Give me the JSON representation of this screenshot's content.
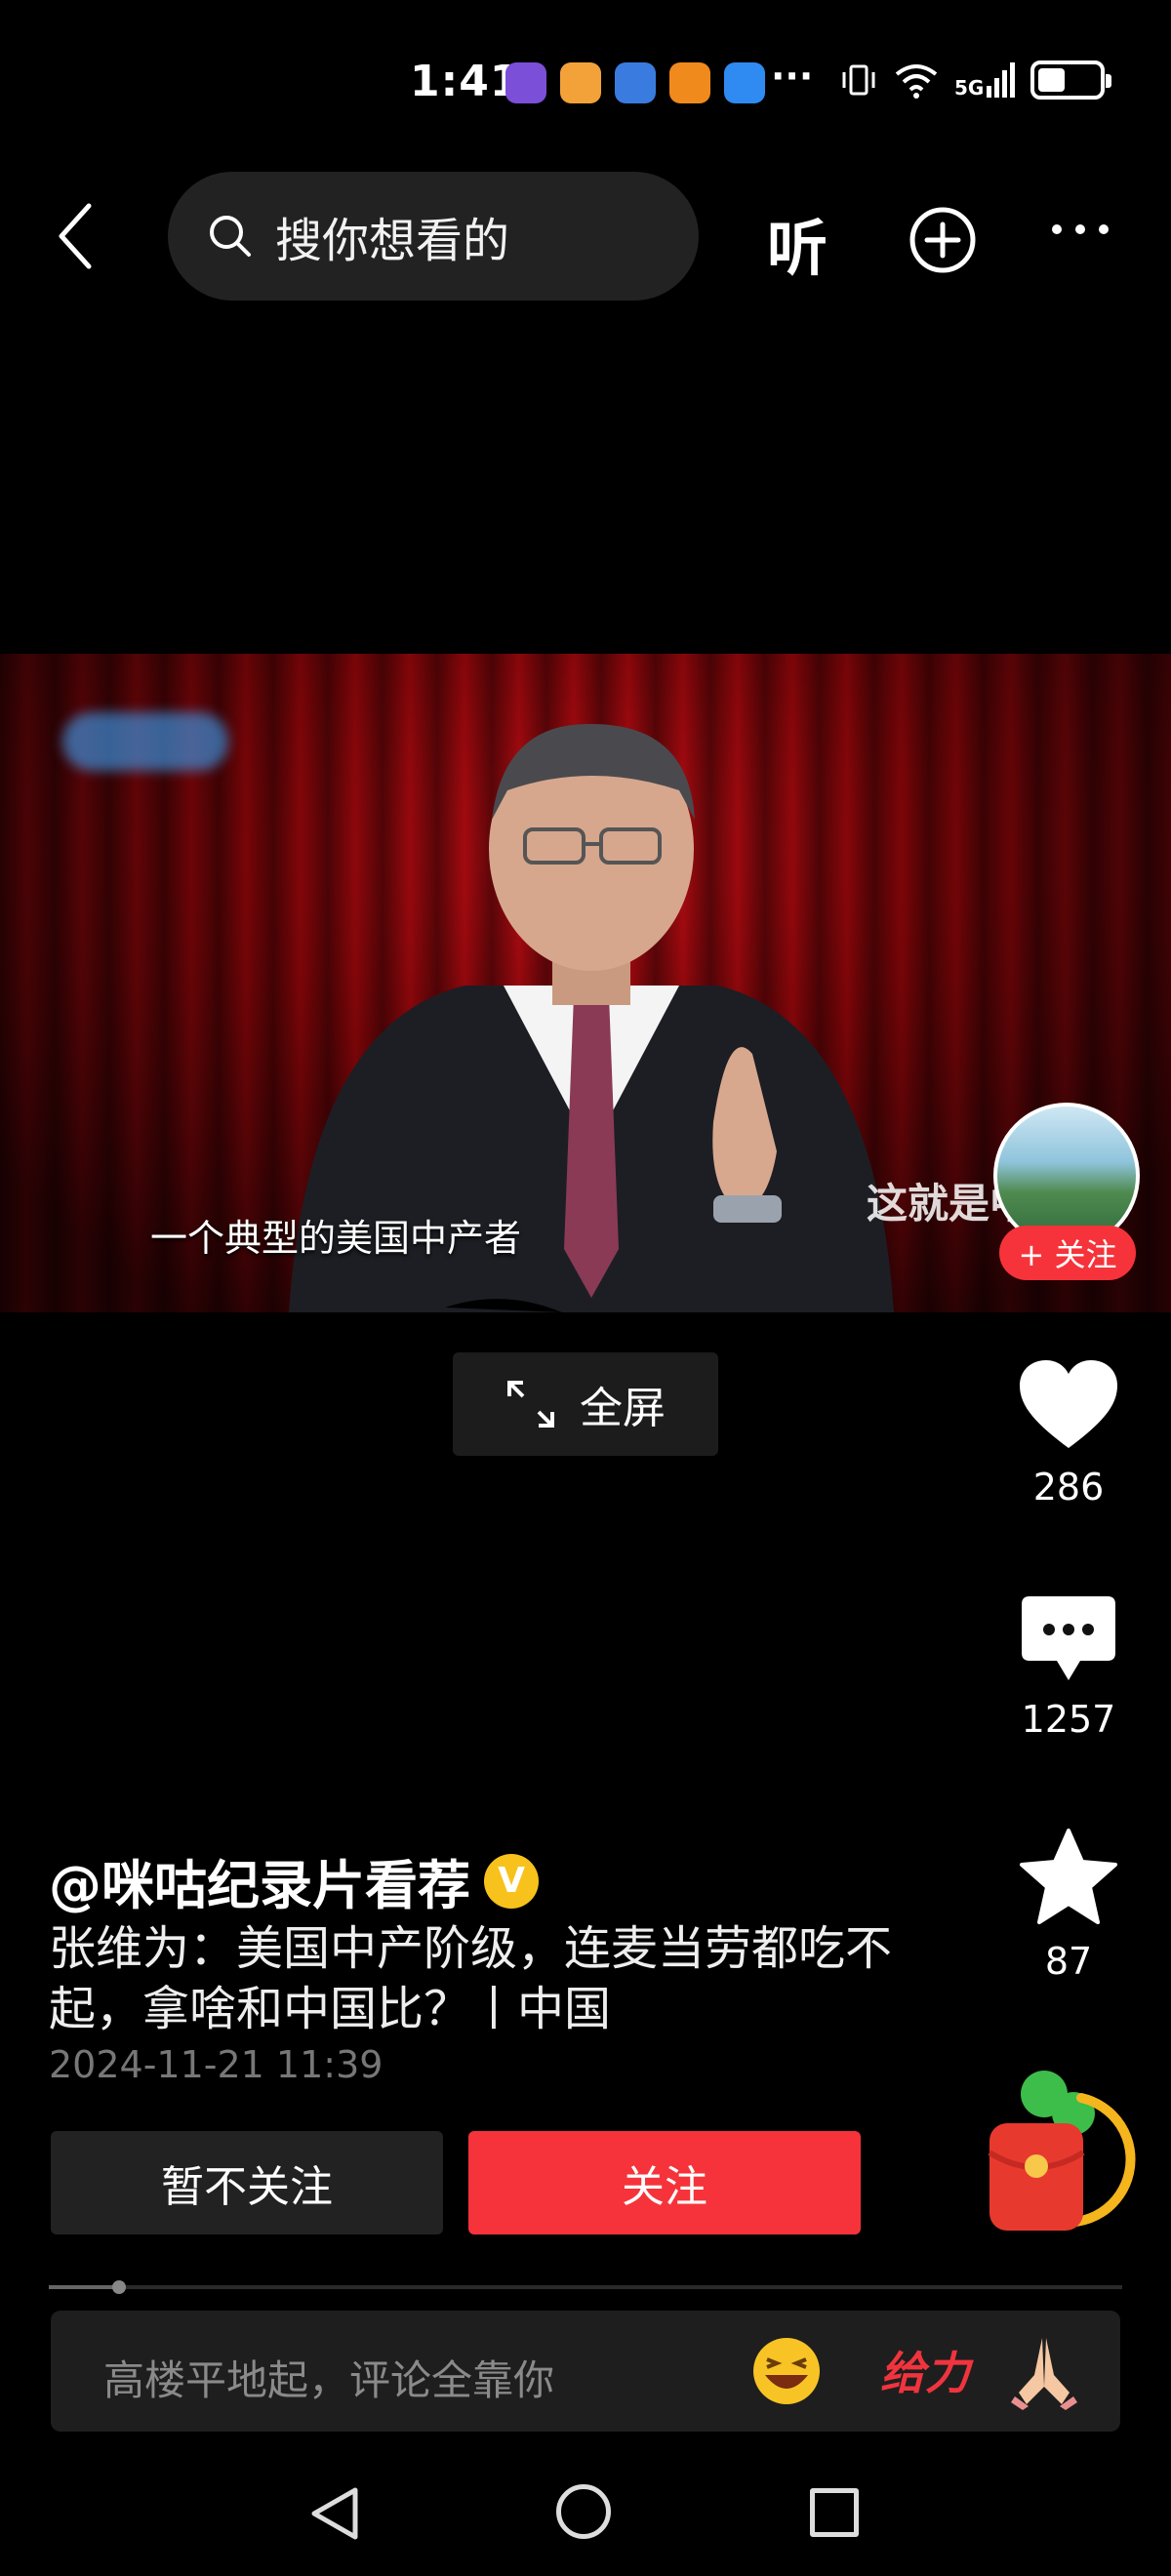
{
  "status_bar": {
    "time": "1:41",
    "more": "···",
    "network": "5G",
    "battery_level": 0.45,
    "app_icon_colors": [
      "#7b4fd8",
      "#f3a23a",
      "#3a7be0",
      "#f08a1c",
      "#2f8bf2"
    ]
  },
  "top_bar": {
    "back_icon": "chevron-left-icon",
    "search_placeholder": "搜你想看的",
    "listen_label": "听",
    "add_icon": "plus-circle-icon",
    "more_icon": "ellipsis-icon"
  },
  "video": {
    "caption": "一个典型的美国中产者",
    "watermark": "这就是中",
    "follow_pill": "+ 关注"
  },
  "fullscreen": {
    "label": "全屏"
  },
  "rail": {
    "likes": "286",
    "comments": "1257",
    "favorites": "87"
  },
  "post": {
    "author": "@咪咕纪录片看荐",
    "verified_mark": "V",
    "title": "张维为：美国中产阶级，连麦当劳都吃不起，拿啥和中国比？丨中国",
    "date": "2024-11-21 11:39"
  },
  "actions": {
    "dismiss_label": "暂不关注",
    "follow_label": "关注"
  },
  "playback": {
    "progress": 0.065
  },
  "comment_bar": {
    "placeholder": "高楼平地起，评论全靠你",
    "give_label": "给力"
  },
  "colors": {
    "accent": "#f6333a",
    "verified": "#f7c21b"
  }
}
